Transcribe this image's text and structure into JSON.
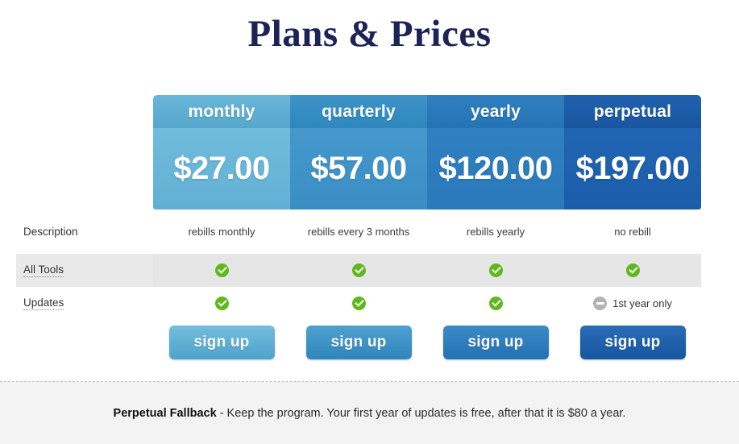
{
  "page": {
    "title": "Plans & Prices"
  },
  "table": {
    "row_labels": {
      "description": "Description",
      "all_tools": "All Tools",
      "updates": "Updates"
    },
    "plans": [
      {
        "name": "monthly",
        "price": "$27.00",
        "description": "rebills monthly",
        "all_tools": {
          "icon": "check-icon",
          "note": ""
        },
        "updates": {
          "icon": "check-icon",
          "note": ""
        },
        "cta": "sign up",
        "accent": "#62b0d4"
      },
      {
        "name": "quarterly",
        "price": "$57.00",
        "description": "rebills every 3 months",
        "all_tools": {
          "icon": "check-icon",
          "note": ""
        },
        "updates": {
          "icon": "check-icon",
          "note": ""
        },
        "cta": "sign up",
        "accent": "#3b8ec4"
      },
      {
        "name": "yearly",
        "price": "$120.00",
        "description": "rebills yearly",
        "all_tools": {
          "icon": "check-icon",
          "note": ""
        },
        "updates": {
          "icon": "check-icon",
          "note": ""
        },
        "cta": "sign up",
        "accent": "#2a79ba"
      },
      {
        "name": "perpetual",
        "price": "$197.00",
        "description": "no rebill",
        "all_tools": {
          "icon": "check-icon",
          "note": ""
        },
        "updates": {
          "icon": "minus-icon",
          "note": "1st year only"
        },
        "cta": "sign up",
        "accent": "#1c5daa"
      }
    ]
  },
  "footer": {
    "heading": "Perpetual Fallback",
    "body": " - Keep the program. Your first year of updates is free, after that it is $80 a year."
  },
  "colors": {
    "title": "#1b2357",
    "check": "#5fb81c",
    "minus": "#b3b3b3",
    "shaded_row": "#e9e9e9",
    "footer_band": "#f3f3f3"
  }
}
